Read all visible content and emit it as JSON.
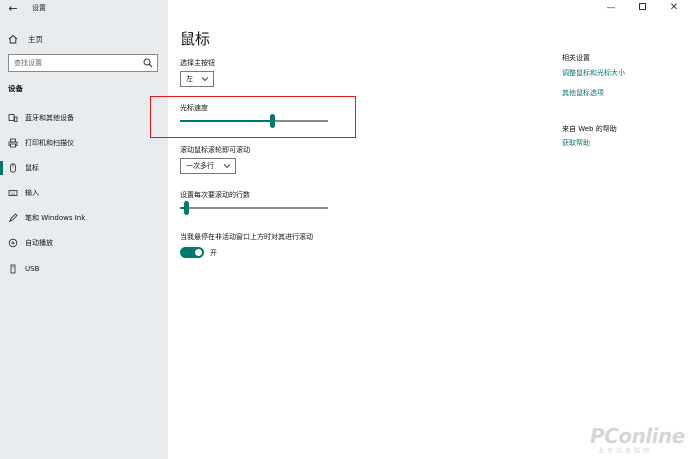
{
  "window": {
    "title": "设置",
    "back_glyph": "←",
    "min_glyph": "—",
    "close_glyph": "✕"
  },
  "sidebar": {
    "home_label": "主页",
    "search": {
      "placeholder": "查找设置",
      "value": ""
    },
    "section_title": "设备",
    "items": [
      {
        "label": "蓝牙和其他设备",
        "icon": "bluetooth-device-icon",
        "active": false
      },
      {
        "label": "打印机和扫描仪",
        "icon": "printer-icon",
        "active": false
      },
      {
        "label": "鼠标",
        "icon": "mouse-icon",
        "active": true
      },
      {
        "label": "输入",
        "icon": "keyboard-icon",
        "active": false
      },
      {
        "label": "笔和 Windows Ink",
        "icon": "pen-icon",
        "active": false
      },
      {
        "label": "自动播放",
        "icon": "autoplay-icon",
        "active": false
      },
      {
        "label": "USB",
        "icon": "usb-icon",
        "active": false
      }
    ]
  },
  "main": {
    "title": "鼠标",
    "primary_button": {
      "label": "选择主按钮",
      "value": "左"
    },
    "cursor_speed": {
      "label": "光标速度",
      "level": 0.63
    },
    "wheel_scroll": {
      "label": "滚动鼠标滚轮即可滚动",
      "value": "一次多行"
    },
    "lines_per_scroll": {
      "label": "设置每次要滚动的行数",
      "level": 0.03
    },
    "inactive_scroll": {
      "label": "当我悬停在非活动窗口上方时对其进行滚动",
      "state": "开",
      "on": true
    }
  },
  "related": {
    "heading": "相关设置",
    "links": [
      "调整鼠标和光标大小",
      "其他鼠标选项"
    ],
    "help_heading": "来自 Web 的帮助",
    "help_link": "获取帮助"
  },
  "watermark": {
    "brand": "PConline",
    "sub": "太平洋电脑网"
  },
  "colors": {
    "accent": "#00786e",
    "highlight": "#e21a1a",
    "sidebar_bg": "#e8ecee"
  }
}
